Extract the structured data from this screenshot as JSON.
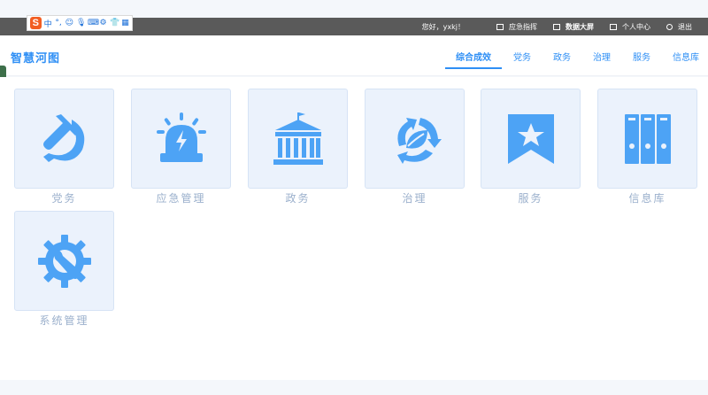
{
  "ime_toolbar": {
    "logo": "S",
    "icons": [
      "中",
      "°,",
      "☺",
      "🎙",
      "⌨",
      "⚙",
      "👕",
      "▦"
    ]
  },
  "topbar": {
    "greeting": "您好，yxkj！",
    "links": [
      {
        "label": "应急指挥",
        "icon": "screen-icon",
        "bold": false
      },
      {
        "label": "数据大屏",
        "icon": "screen-icon",
        "bold": true
      },
      {
        "label": "个人中心",
        "icon": "external-icon",
        "bold": false
      },
      {
        "label": "退出",
        "icon": "logout-icon",
        "bold": false
      }
    ]
  },
  "navbar": {
    "logo": "智慧河图",
    "tabs": [
      {
        "label": "综合成效",
        "active": true
      },
      {
        "label": "党务",
        "active": false
      },
      {
        "label": "政务",
        "active": false
      },
      {
        "label": "治理",
        "active": false
      },
      {
        "label": "服务",
        "active": false
      },
      {
        "label": "信息库",
        "active": false
      }
    ]
  },
  "tiles": [
    {
      "label": "党务",
      "icon": "hammer-sickle-icon"
    },
    {
      "label": "应急管理",
      "icon": "alarm-light-icon"
    },
    {
      "label": "政务",
      "icon": "government-building-icon"
    },
    {
      "label": "治理",
      "icon": "recycle-leaf-icon"
    },
    {
      "label": "服务",
      "icon": "star-ribbon-icon"
    },
    {
      "label": "信息库",
      "icon": "binders-icon"
    },
    {
      "label": "系统管理",
      "icon": "gear-wrench-icon"
    }
  ],
  "colors": {
    "accent": "#2f8ff5",
    "icon_blue": "#4da3f5",
    "tile_bg": "#ebf2fc",
    "label_gray": "#9bb0cc",
    "topbar_bg": "#5a5a5a"
  }
}
